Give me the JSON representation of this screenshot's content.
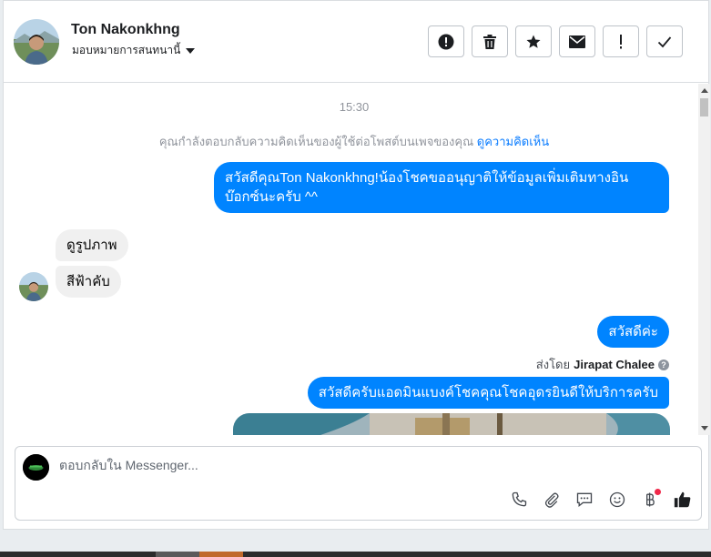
{
  "header": {
    "name": "Ton Nakonkhng",
    "assign_label": "มอบหมายการสนทนานี้",
    "actions": [
      {
        "icon": "alert-circle-icon",
        "name": "mark-spam-button"
      },
      {
        "icon": "trash-icon",
        "name": "delete-button"
      },
      {
        "icon": "star-icon",
        "name": "star-button"
      },
      {
        "icon": "envelope-icon",
        "name": "mark-unread-button"
      },
      {
        "icon": "exclamation-icon",
        "name": "follow-up-button"
      },
      {
        "icon": "check-icon",
        "name": "mark-done-button"
      }
    ]
  },
  "thread": {
    "time": "15:30",
    "notice": "คุณกำลังตอบกลับความคิดเห็นของผู้ใช้ต่อโพสต์บนเพจของคุณ",
    "notice_link": "ดูความคิดเห็น",
    "messages": {
      "out1": "สวัสดีคุณTon Nakonkhng!น้องโชคขออนุญาติให้ข้อมูลเพิ่มเติมทางอินบ๊อกซ์นะครับ ^^",
      "in1": "ดูรูปภาพ",
      "in2": "สีฟ้าคับ",
      "out2": "สวัสดีค่ะ",
      "sent_by_label": "ส่งโดย",
      "sent_by_name": "Jirapat Chalee",
      "out3": "สวัสดีครับแอดมินแบงค์โชคคุณโชคอุดรยินดีให้บริการครับ"
    }
  },
  "composer": {
    "placeholder": "ตอบกลับใน Messenger...",
    "tools": [
      "phone-icon",
      "paperclip-icon",
      "chat-bubble-icon",
      "emoji-icon",
      "baht-icon",
      "thumbs-up-icon"
    ]
  },
  "colors": {
    "accent": "#0084ff",
    "incoming": "#f0f0f0",
    "link": "#0a7cff"
  }
}
